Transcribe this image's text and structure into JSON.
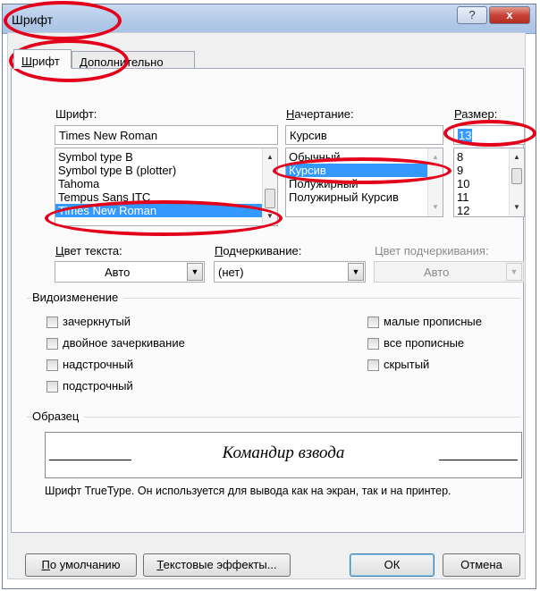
{
  "window": {
    "title": "Шрифт",
    "help_glyph": "?",
    "close_glyph": "x"
  },
  "tabs": [
    {
      "label": "Шрифт",
      "hotkey_prefix": "",
      "hotkey": "Ш",
      "rest": "рифт",
      "active": true
    },
    {
      "label": "Дополнительно",
      "hotkey_prefix": "",
      "hotkey": "Д",
      "rest": "ополнительно",
      "active": false
    }
  ],
  "font": {
    "label": "Шрифт:",
    "value": "Times New Roman",
    "list": [
      "Symbol type B",
      "Symbol type B (plotter)",
      "Tahoma",
      "Tempus Sans ITC",
      "Times New Roman"
    ],
    "selected": "Times New Roman"
  },
  "style": {
    "label": "Начертание:",
    "value": "Курсив",
    "list": [
      "Обычный",
      "Курсив",
      "Полужирный",
      "Полужирный Курсив"
    ],
    "selected": "Курсив"
  },
  "size": {
    "label": "Размер:",
    "value": "13",
    "list": [
      "8",
      "9",
      "10",
      "11",
      "12"
    ]
  },
  "text_color": {
    "label": "Цвет текста:",
    "value": "Авто"
  },
  "underline": {
    "label": "Подчеркивание:",
    "value": "(нет)"
  },
  "underline_color": {
    "label": "Цвет подчеркивания:",
    "value": "Авто"
  },
  "effects": {
    "label": "Видоизменение",
    "left": [
      "зачеркнутый",
      "двойное зачеркивание",
      "надстрочный",
      "подстрочный"
    ],
    "right": [
      "малые прописные",
      "все прописные",
      "скрытый"
    ]
  },
  "preview": {
    "label": "Образец",
    "sample_text": "Командир взвода",
    "note": "Шрифт TrueType. Он используется для вывода как на экран, так и на принтер."
  },
  "buttons": {
    "default": "По умолчанию",
    "text_effects": "Текстовые эффекты...",
    "ok": "ОК",
    "cancel": "Отмена"
  },
  "colors": {
    "selection": "#3399ff",
    "annotation_ring": "#e3001b",
    "close_button": "#c7423a"
  }
}
